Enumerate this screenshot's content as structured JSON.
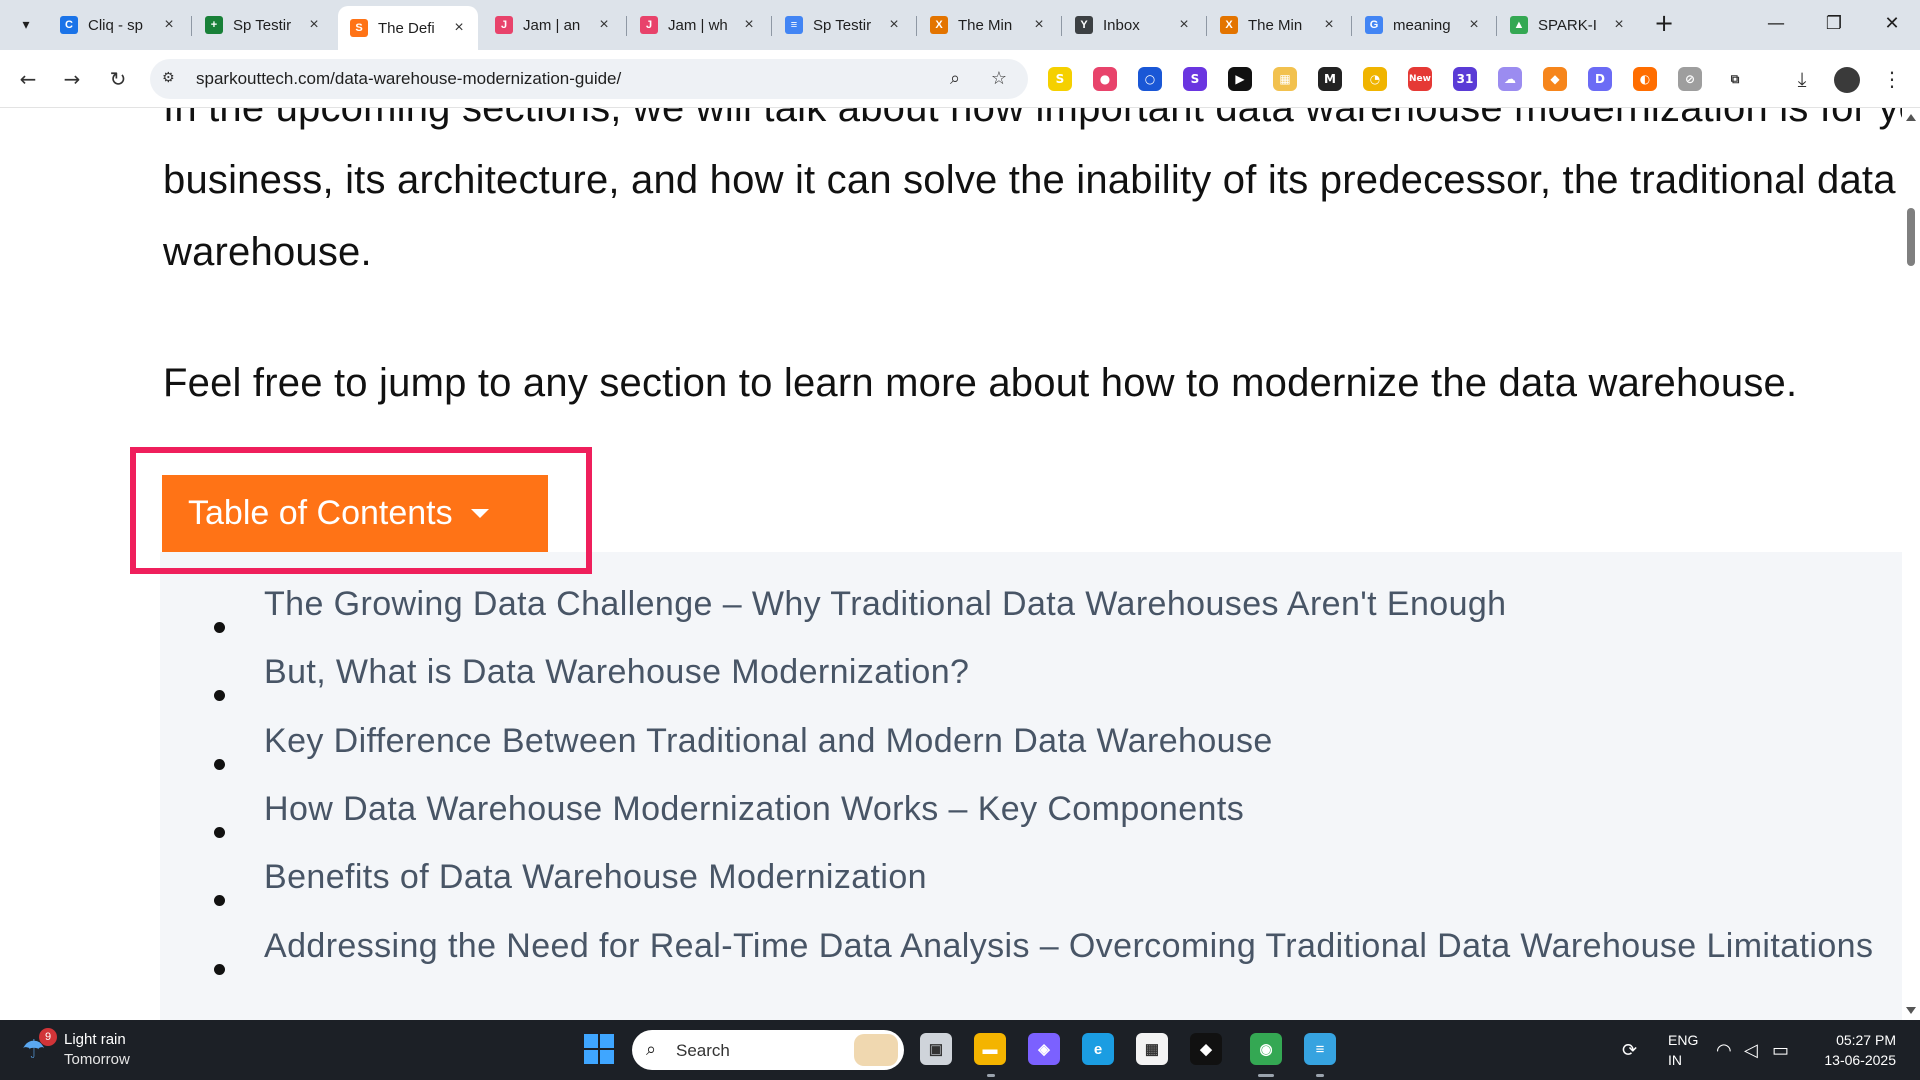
{
  "tabs": [
    {
      "title": "Cliq - sp",
      "favicon": "cliq-icon",
      "color": "#1a73e8",
      "glyph": "C"
    },
    {
      "title": "Sp Testir",
      "favicon": "sheets-icon",
      "color": "#188038",
      "glyph": "+"
    },
    {
      "title": "The Defi",
      "favicon": "sparkouttech-icon",
      "color": "#ff7316",
      "glyph": "S"
    },
    {
      "title": "Jam | an",
      "favicon": "jam-icon",
      "color": "#e8436b",
      "glyph": "J"
    },
    {
      "title": "Jam | wh",
      "favicon": "jam-icon",
      "color": "#e8436b",
      "glyph": "J"
    },
    {
      "title": "Sp Testir",
      "favicon": "docs-icon",
      "color": "#4285f4",
      "glyph": "≡"
    },
    {
      "title": "The Min",
      "favicon": "x-icon",
      "color": "#e37400",
      "glyph": "X"
    },
    {
      "title": "Inbox",
      "favicon": "yahoo-mail-icon",
      "color": "#3c4043",
      "glyph": "Y"
    },
    {
      "title": "The Min",
      "favicon": "x-icon",
      "color": "#e37400",
      "glyph": "X"
    },
    {
      "title": "meaning",
      "favicon": "google-icon",
      "color": "#4285f4",
      "glyph": "G"
    },
    {
      "title": "SPARK-I",
      "favicon": "drive-icon",
      "color": "#34a853",
      "glyph": "▲"
    }
  ],
  "tab_close": "×",
  "new_tab": "+",
  "window": {
    "minimize": "—",
    "maximize": "❐",
    "close": "✕"
  },
  "nav": {
    "back": "←",
    "forward": "→",
    "reload": "↻"
  },
  "omnibox": {
    "url": "sparkouttech.com/data-warehouse-modernization-guide/",
    "site_info": "⚙",
    "zoom": "⌕",
    "bookmark": "☆"
  },
  "extensions": [
    {
      "name": "s-extension-icon",
      "color": "#f5d000",
      "glyph": "S"
    },
    {
      "name": "jam-extension-icon",
      "color": "#e8436b",
      "glyph": "●"
    },
    {
      "name": "circle-extension-icon",
      "color": "#1a57d6",
      "glyph": "○"
    },
    {
      "name": "s-blue-extension-icon",
      "color": "#6a35e0",
      "glyph": "S"
    },
    {
      "name": "play-extension-icon",
      "color": "#111111",
      "glyph": "▶"
    },
    {
      "name": "yellow-extension-icon",
      "color": "#f2c14e",
      "glyph": "▦"
    },
    {
      "name": "media-extension-icon",
      "color": "#222222",
      "glyph": "M"
    },
    {
      "name": "gauge-extension-icon",
      "color": "#f0b400",
      "glyph": "◔"
    },
    {
      "name": "new-extension-icon",
      "color": "#e53935",
      "glyph": "New"
    },
    {
      "name": "calendar-extension-icon",
      "color": "#5a3bd6",
      "glyph": "31"
    },
    {
      "name": "cloud-extension-icon",
      "color": "#9b8cf0",
      "glyph": "☁"
    },
    {
      "name": "metamask-extension-icon",
      "color": "#f6851b",
      "glyph": "◆"
    },
    {
      "name": "d-extension-icon",
      "color": "#6b6bf5",
      "glyph": "D"
    },
    {
      "name": "orange-extension-icon",
      "color": "#ff6d00",
      "glyph": "◐"
    },
    {
      "name": "compass-extension-icon",
      "color": "#9e9e9e",
      "glyph": "⊘"
    },
    {
      "name": "puzzle-extension-icon",
      "color": "#ffffff",
      "glyph": "⧉"
    }
  ],
  "toolbar_right": {
    "download": "⤓",
    "menu": "⋮"
  },
  "content": {
    "para1_line1": "In the upcoming sections, we will talk about how important data warehouse modernization is for your",
    "para1_line2": "business, its architecture, and how it can solve the inability of its predecessor, the traditional data",
    "para1_line3": "warehouse.",
    "para2": "Feel free to jump to any section to learn more about how to modernize the data warehouse.",
    "toc_button": "Table of Contents",
    "toc_items": [
      "The Growing Data Challenge – Why Traditional Data Warehouses Aren't Enough",
      "But, What is Data Warehouse Modernization?",
      "Key Difference Between Traditional and Modern Data Warehouse",
      "How Data Warehouse Modernization Works – Key Components",
      "Benefits of Data Warehouse Modernization",
      "Addressing the Need for Real-Time Data Analysis – Overcoming Traditional Data Warehouse Limitations"
    ]
  },
  "colors": {
    "toc_button": "#ff7316",
    "highlight_frame": "#ef1f5c",
    "toc_panel": "#f4f6f9",
    "toc_link": "#485566"
  },
  "taskbar": {
    "weather_badge": "9",
    "weather_line1": "Light rain",
    "weather_line2": "Tomorrow",
    "search_placeholder": "Search",
    "apps": [
      {
        "name": "task-view-icon",
        "color": "#cfd4da",
        "glyph": "▣"
      },
      {
        "name": "file-explorer-icon",
        "color": "#f4b400",
        "glyph": "▬"
      },
      {
        "name": "copilot-icon",
        "color": "#7b61ff",
        "glyph": "◈"
      },
      {
        "name": "edge-icon",
        "color": "#1b9de2",
        "glyph": "e"
      },
      {
        "name": "store-icon",
        "color": "#f3f3f3",
        "glyph": "▦"
      },
      {
        "name": "binance-icon",
        "color": "#111111",
        "glyph": "◆"
      },
      {
        "name": "chrome-icon",
        "color": "#34a853",
        "glyph": "◉"
      },
      {
        "name": "notepad-icon",
        "color": "#36a3e0",
        "glyph": "≡"
      }
    ],
    "lang1": "ENG",
    "lang2": "IN",
    "time": "05:27 PM",
    "date": "13-06-2025"
  }
}
